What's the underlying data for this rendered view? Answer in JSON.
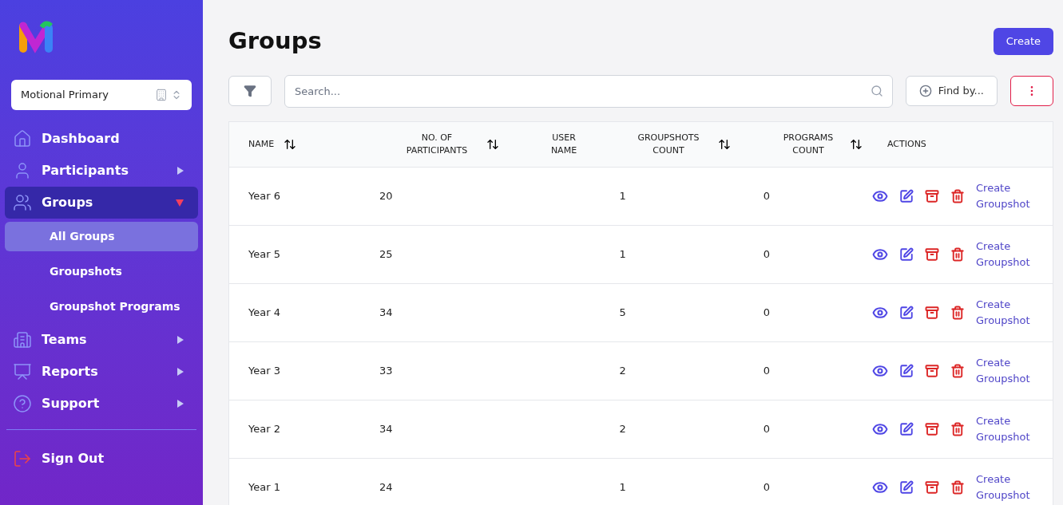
{
  "sidebar": {
    "org_select": {
      "value": "Motional Primary"
    },
    "nav": [
      {
        "kind": "home",
        "label": "Dashboard",
        "selected": false
      },
      {
        "kind": "person",
        "label": "Participants",
        "selected": false,
        "expanded": false
      },
      {
        "kind": "people",
        "label": "Groups",
        "selected": true,
        "expanded": true,
        "children": [
          {
            "label": "All Groups",
            "selected": true
          },
          {
            "label": "Groupshots",
            "selected": false
          },
          {
            "label": "Groupshot Programs",
            "selected": false
          }
        ]
      },
      {
        "kind": "building",
        "label": "Teams",
        "selected": false,
        "expanded": false
      },
      {
        "kind": "chart",
        "label": "Reports",
        "selected": false,
        "expanded": false
      },
      {
        "kind": "help",
        "label": "Support",
        "selected": false,
        "expanded": false
      }
    ],
    "sign_out": "Sign Out"
  },
  "page": {
    "title": "Groups",
    "create_button": "Create",
    "search": {
      "placeholder": "Search..."
    },
    "find_by": "Find by..."
  },
  "table": {
    "columns": [
      {
        "label": "NAME",
        "sortable": true
      },
      {
        "label": "NO. OF PARTICIPANTS",
        "sortable": true
      },
      {
        "label": "USER NAME",
        "sortable": false
      },
      {
        "label": "GROUPSHOTS COUNT",
        "sortable": true
      },
      {
        "label": "PROGRAMS COUNT",
        "sortable": true
      },
      {
        "label": "ACTIONS",
        "sortable": false
      }
    ],
    "rows": [
      {
        "name": "Year 6",
        "participants": "20",
        "groupshots": "1",
        "programs": "0",
        "link": "Create Groupshot"
      },
      {
        "name": "Year 5",
        "participants": "25",
        "groupshots": "1",
        "programs": "0",
        "link": "Create Groupshot"
      },
      {
        "name": "Year 4",
        "participants": "34",
        "groupshots": "5",
        "programs": "0",
        "link": "Create Groupshot"
      },
      {
        "name": "Year 3",
        "participants": "33",
        "groupshots": "2",
        "programs": "0",
        "link": "Create Groupshot"
      },
      {
        "name": "Year 2",
        "participants": "34",
        "groupshots": "2",
        "programs": "0",
        "link": "Create Groupshot"
      },
      {
        "name": "Year 1",
        "participants": "24",
        "groupshots": "1",
        "programs": "0",
        "link": "Create Groupshot"
      }
    ]
  }
}
